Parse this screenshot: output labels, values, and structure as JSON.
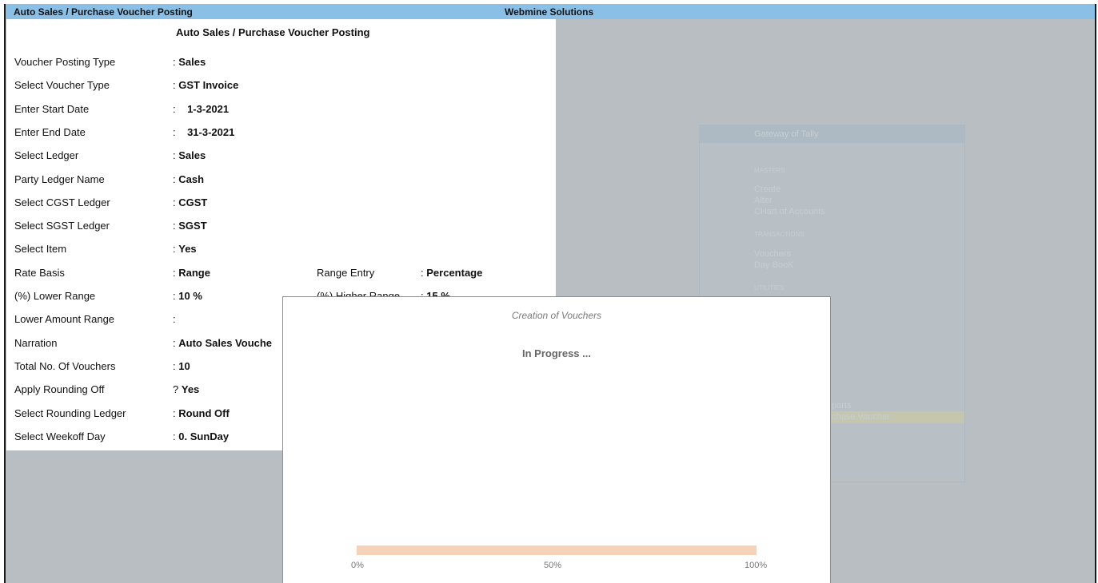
{
  "window": {
    "title": "Auto Sales / Purchase Voucher Posting",
    "company": "Webmine Solutions"
  },
  "form": {
    "heading": "Auto Sales / Purchase Voucher Posting",
    "fields": [
      {
        "label": "Voucher Posting Type",
        "sep": ":",
        "value": "Sales"
      },
      {
        "label": "Select Voucher Type",
        "sep": ":",
        "value": "GST Invoice"
      },
      {
        "label": "Enter Start Date",
        "sep": ":",
        "value": "1-3-2021"
      },
      {
        "label": "Enter End Date",
        "sep": ":",
        "value": "31-3-2021"
      },
      {
        "label": "Select Ledger",
        "sep": ":",
        "value": "Sales"
      },
      {
        "label": "Party Ledger Name",
        "sep": ":",
        "value": "Cash"
      },
      {
        "label": "Select CGST Ledger",
        "sep": ":",
        "value": "CGST"
      },
      {
        "label": "Select SGST Ledger",
        "sep": ":",
        "value": "SGST"
      },
      {
        "label": "Select Item",
        "sep": ":",
        "value": "Yes"
      },
      {
        "label": "Rate Basis",
        "sep": ":",
        "value": "Range"
      },
      {
        "label": "(%) Lower Range",
        "sep": ":",
        "value": "10 %"
      },
      {
        "label": "Lower Amount Range",
        "sep": ":",
        "value": ""
      },
      {
        "label": "Narration",
        "sep": ":",
        "value": "Auto Sales Vouche"
      },
      {
        "label": "Total No. Of Vouchers",
        "sep": ":",
        "value": "10"
      },
      {
        "label": "Apply Rounding Off",
        "sep": "?",
        "value": "Yes"
      },
      {
        "label": "Select Rounding Ledger",
        "sep": ":",
        "value": "Round Off"
      },
      {
        "label": "Select Weekoff Day",
        "sep": ":",
        "value": "0. SunDay"
      }
    ],
    "range_entry": {
      "label": "Range Entry",
      "sep": ":",
      "value": "Percentage"
    },
    "higher_range": {
      "label": "(%) Higher Range",
      "sep": ":",
      "value": "15 %"
    }
  },
  "gateway": {
    "title": "Gateway of Tally",
    "masters_header": "MASTERS",
    "masters": [
      "Create",
      "Alter",
      "CHart of Accounts"
    ],
    "transactions_header": "TRANSACTIONS",
    "transactions": [
      "Vouchers",
      "Day BooK"
    ],
    "utilities_header": "UTILITIES",
    "partial_item_1": "ports",
    "partial_item_2": "chase Voucher"
  },
  "dialog": {
    "title": "Creation of Vouchers",
    "status": "In Progress ...",
    "progress": 0,
    "labels": {
      "start": "0%",
      "mid": "50%",
      "end": "100%"
    }
  }
}
